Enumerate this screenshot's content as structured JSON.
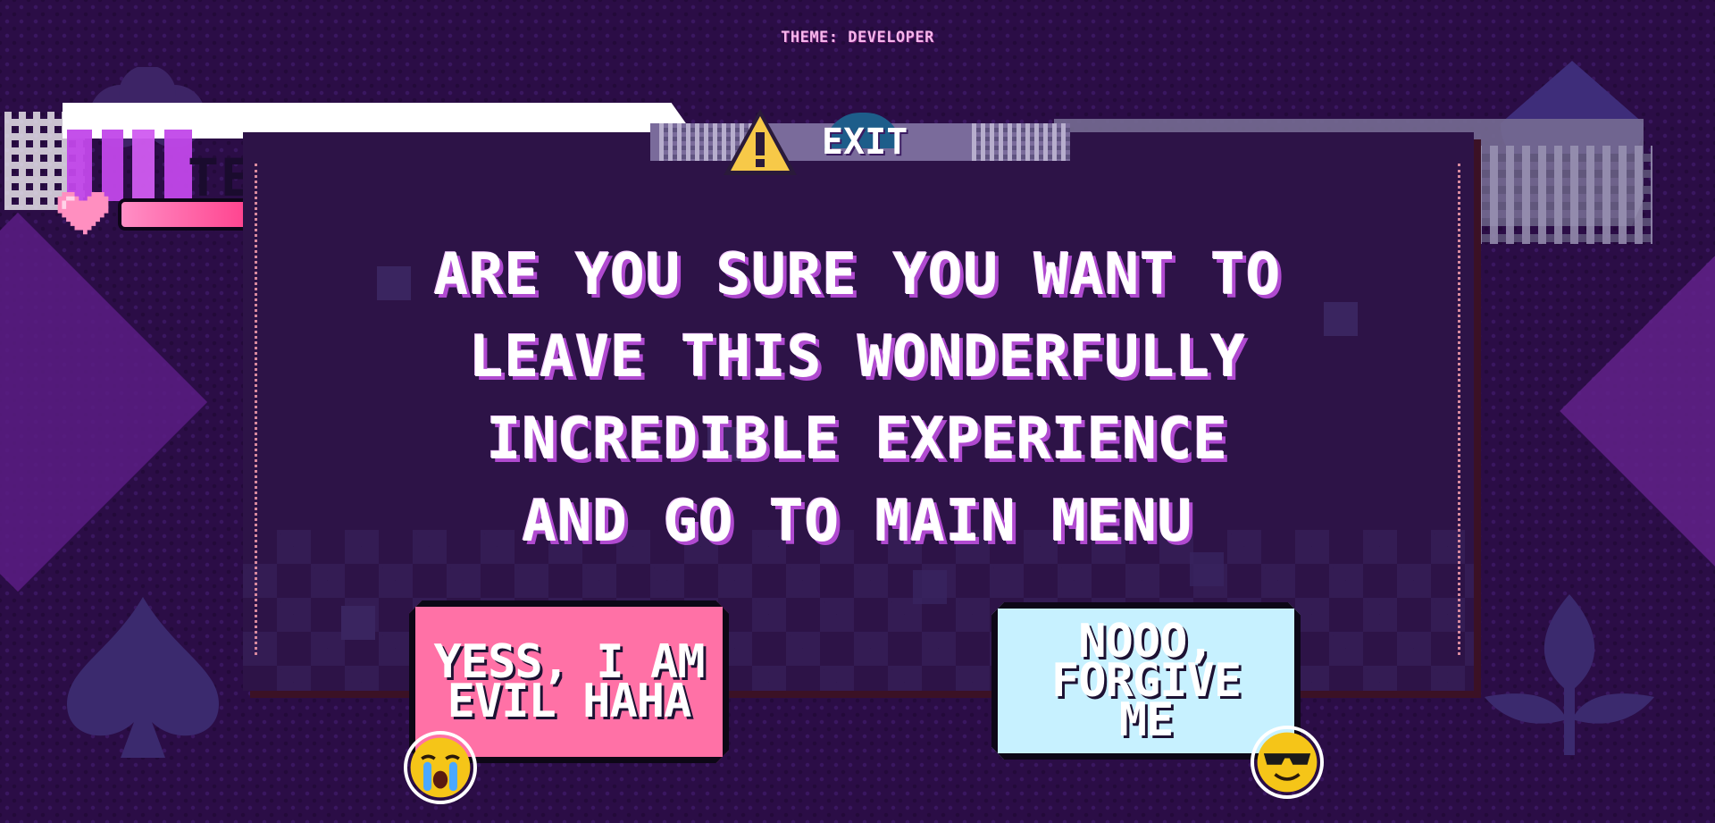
{
  "theme_label": "THEME: DEVELOPER",
  "hud": {
    "title_fragment": "TE"
  },
  "dialog": {
    "tab_title": "EXIT",
    "message": "ARE YOU SURE YOU WANT TO LEAVE THIS WONDERFULLY INCREDIBLE EXPERIENCE AND GO TO MAIN MENU",
    "confirm_label": "YESS, I AM EVIL HAHA",
    "cancel_label": "NOOO, FORGIVE ME"
  },
  "icons": {
    "warning": "warning-triangle-icon",
    "confirm_emoji": "crying-face-icon",
    "cancel_emoji": "sunglasses-face-icon",
    "health": "heart-icon"
  },
  "colors": {
    "background": "#2b0d46",
    "modal": "#2d1347",
    "confirm_button": "#ff71a6",
    "cancel_button": "#c7f1ff",
    "text_shadow": "#b04ad0"
  }
}
